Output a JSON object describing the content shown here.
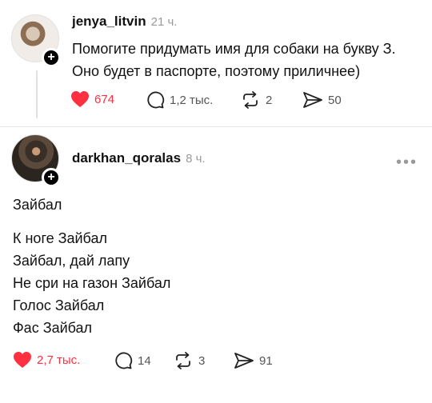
{
  "posts": [
    {
      "username": "jenya_litvin",
      "time": "21 ч.",
      "lines": [
        "Помогите придумать имя для собаки на букву З.",
        "Оно будет в паспорте, поэтому приличнее)"
      ],
      "likes": "674",
      "comments": "1,2 тыс.",
      "reposts": "2",
      "shares": "50",
      "liked": true
    },
    {
      "username": "darkhan_qoralas",
      "time": "8 ч.",
      "lines": [
        "Зайбал",
        "",
        "К ноге Зайбал",
        "Зайбал, дай лапу",
        "Не сри на газон Зайбал",
        "Голос Зайбал",
        "Фас Зайбал"
      ],
      "likes": "2,7 тыс.",
      "comments": "14",
      "reposts": "3",
      "shares": "91",
      "liked": true
    }
  ],
  "icons": {
    "follow": "+",
    "more": "•••"
  },
  "colors": {
    "like": "#ff3040",
    "muted": "#9a9a9a"
  }
}
